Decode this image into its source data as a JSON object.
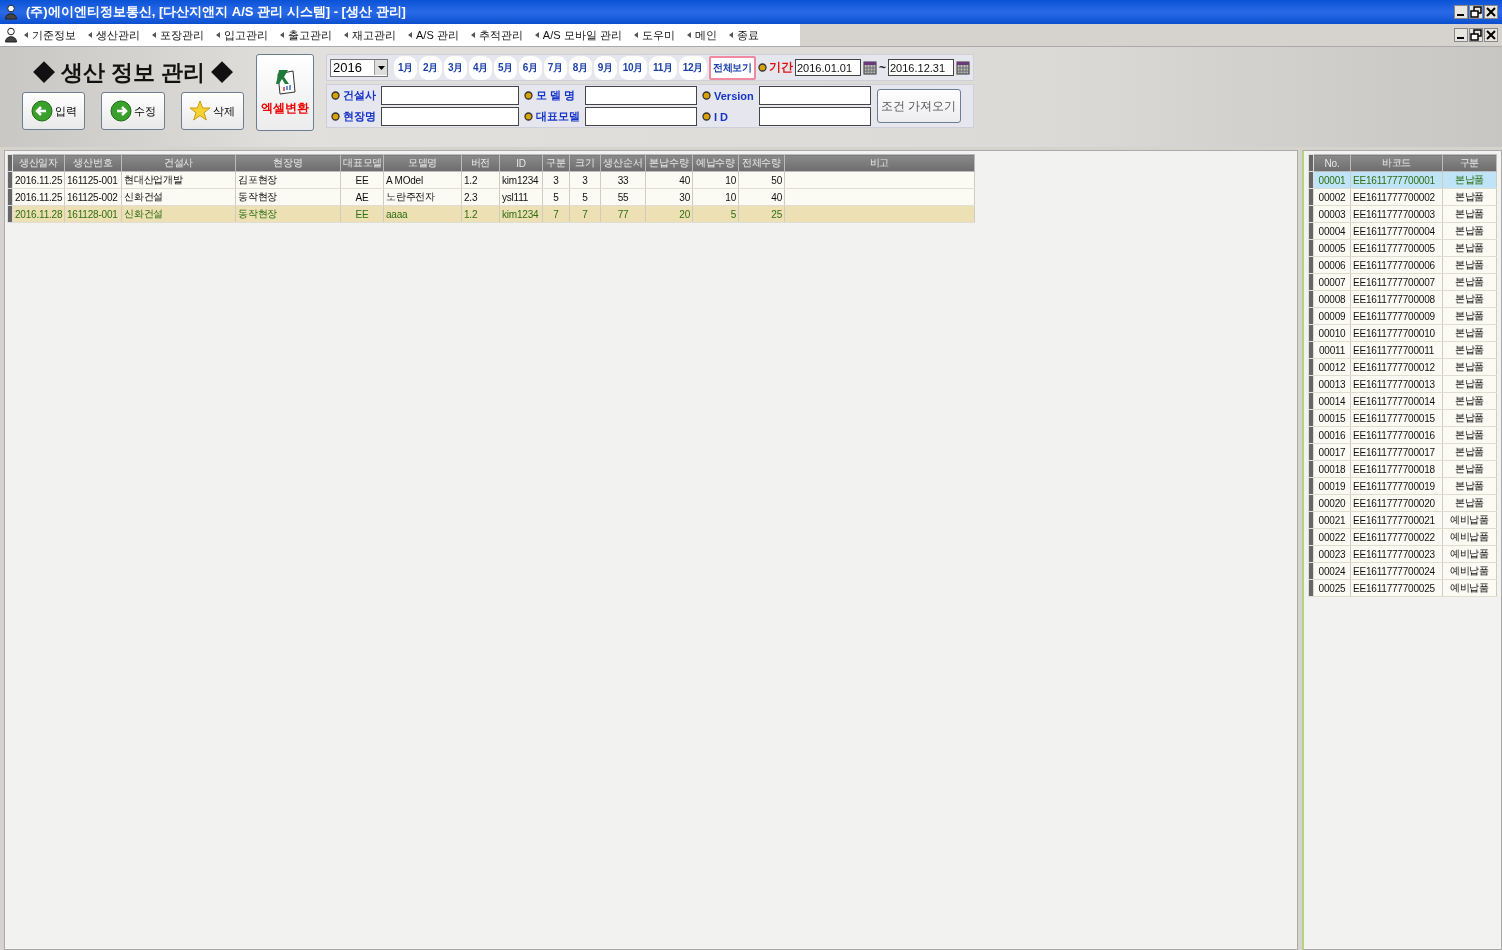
{
  "title_bar": {
    "title": "(주)에이엔티정보통신, [다산지앤지 A/S 관리 시스템] - [생산 관리]"
  },
  "menu": [
    {
      "label": "기준정보"
    },
    {
      "label": "생산관리"
    },
    {
      "label": "포장관리"
    },
    {
      "label": "입고관리"
    },
    {
      "label": "출고관리"
    },
    {
      "label": "재고관리"
    },
    {
      "label": "A/S 관리"
    },
    {
      "label": "추적관리"
    },
    {
      "label": "A/S 모바일 관리"
    },
    {
      "label": "도우미"
    },
    {
      "label": "메인"
    },
    {
      "label": "종료"
    }
  ],
  "page": {
    "title": "◆ 생산 정보 관리 ◆",
    "buttons": [
      {
        "label": "입력",
        "kind": "back"
      },
      {
        "label": "수정",
        "kind": "forward"
      },
      {
        "label": "삭제",
        "kind": "star"
      }
    ],
    "excel_button": {
      "label": "엑셀변환"
    }
  },
  "filters": {
    "year": "2016",
    "months": [
      {
        "label": "1月",
        "selected": false
      },
      {
        "label": "2月",
        "selected": false
      },
      {
        "label": "3月",
        "selected": false
      },
      {
        "label": "4月",
        "selected": false
      },
      {
        "label": "5月",
        "selected": false
      },
      {
        "label": "6月",
        "selected": false
      },
      {
        "label": "7月",
        "selected": false
      },
      {
        "label": "8月",
        "selected": false
      },
      {
        "label": "9月",
        "selected": false
      },
      {
        "label": "10月",
        "selected": false
      },
      {
        "label": "11月",
        "selected": false
      },
      {
        "label": "12月",
        "selected": false
      },
      {
        "label": "전체보기",
        "selected": true
      }
    ],
    "period": {
      "label": "기간",
      "from": "2016.01.01",
      "separator": "~",
      "to": "2016.12.31"
    },
    "fields": [
      {
        "label": "건설사"
      },
      {
        "label": "모 델 명"
      },
      {
        "label": "Version"
      },
      {
        "label": "현장명"
      },
      {
        "label": "대표모델"
      },
      {
        "label": "I D"
      }
    ],
    "fetch_button": {
      "label": "조건 가져오기"
    }
  },
  "production_table": {
    "columns": [
      "생산일자",
      "생산번호",
      "건설사",
      "현장명",
      "대표모델",
      "모델명",
      "버전",
      "ID",
      "구분",
      "크기",
      "생산순서",
      "본납수량",
      "예납수량",
      "전체수량",
      "비고"
    ],
    "rows": [
      {
        "cells": [
          "2016.11.25",
          "161125-001",
          "현대산업개발",
          "김포현장",
          "EE",
          "A MOdel",
          "1.2",
          "kim1234",
          "3",
          "3",
          "33",
          "40",
          "10",
          "50",
          ""
        ],
        "selected": false
      },
      {
        "cells": [
          "2016.11.25",
          "161125-002",
          "신화건설",
          "동작현장",
          "AE",
          "노란주전자",
          "2.3",
          "ysl111",
          "5",
          "5",
          "55",
          "30",
          "10",
          "40",
          ""
        ],
        "selected": false
      },
      {
        "cells": [
          "2016.11.28",
          "161128-001",
          "신화건설",
          "동작현장",
          "EE",
          "aaaa",
          "1.2",
          "kim1234",
          "7",
          "7",
          "77",
          "20",
          "5",
          "25",
          ""
        ],
        "selected": true
      }
    ]
  },
  "barcode_table": {
    "columns": [
      "No.",
      "바코드",
      "구분"
    ],
    "rows": [
      {
        "cells": [
          "00001",
          "EE1611777700001",
          "본납품"
        ],
        "selected": true
      },
      {
        "cells": [
          "00002",
          "EE1611777700002",
          "본납품"
        ],
        "selected": false
      },
      {
        "cells": [
          "00003",
          "EE1611777700003",
          "본납품"
        ],
        "selected": false
      },
      {
        "cells": [
          "00004",
          "EE1611777700004",
          "본납품"
        ],
        "selected": false
      },
      {
        "cells": [
          "00005",
          "EE1611777700005",
          "본납품"
        ],
        "selected": false
      },
      {
        "cells": [
          "00006",
          "EE1611777700006",
          "본납품"
        ],
        "selected": false
      },
      {
        "cells": [
          "00007",
          "EE1611777700007",
          "본납품"
        ],
        "selected": false
      },
      {
        "cells": [
          "00008",
          "EE1611777700008",
          "본납품"
        ],
        "selected": false
      },
      {
        "cells": [
          "00009",
          "EE1611777700009",
          "본납품"
        ],
        "selected": false
      },
      {
        "cells": [
          "00010",
          "EE1611777700010",
          "본납품"
        ],
        "selected": false
      },
      {
        "cells": [
          "00011",
          "EE1611777700011",
          "본납품"
        ],
        "selected": false
      },
      {
        "cells": [
          "00012",
          "EE1611777700012",
          "본납품"
        ],
        "selected": false
      },
      {
        "cells": [
          "00013",
          "EE1611777700013",
          "본납품"
        ],
        "selected": false
      },
      {
        "cells": [
          "00014",
          "EE1611777700014",
          "본납품"
        ],
        "selected": false
      },
      {
        "cells": [
          "00015",
          "EE1611777700015",
          "본납품"
        ],
        "selected": false
      },
      {
        "cells": [
          "00016",
          "EE1611777700016",
          "본납품"
        ],
        "selected": false
      },
      {
        "cells": [
          "00017",
          "EE1611777700017",
          "본납품"
        ],
        "selected": false
      },
      {
        "cells": [
          "00018",
          "EE1611777700018",
          "본납품"
        ],
        "selected": false
      },
      {
        "cells": [
          "00019",
          "EE1611777700019",
          "본납품"
        ],
        "selected": false
      },
      {
        "cells": [
          "00020",
          "EE1611777700020",
          "본납품"
        ],
        "selected": false
      },
      {
        "cells": [
          "00021",
          "EE1611777700021",
          "예비납품"
        ],
        "selected": false
      },
      {
        "cells": [
          "00022",
          "EE1611777700022",
          "예비납품"
        ],
        "selected": false
      },
      {
        "cells": [
          "00023",
          "EE1611777700023",
          "예비납품"
        ],
        "selected": false
      },
      {
        "cells": [
          "00024",
          "EE1611777700024",
          "예비납품"
        ],
        "selected": false
      },
      {
        "cells": [
          "00025",
          "EE1611777700025",
          "예비납품"
        ],
        "selected": false
      }
    ]
  }
}
